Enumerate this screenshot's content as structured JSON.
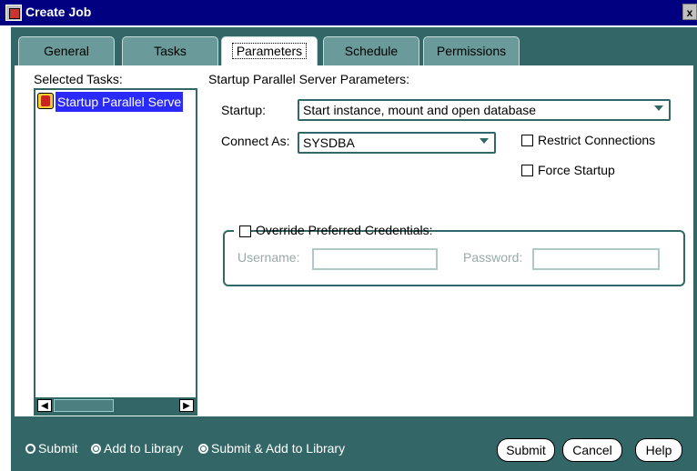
{
  "window": {
    "title": "Create Job",
    "close_label": "x"
  },
  "tabs": [
    {
      "label": "General"
    },
    {
      "label": "Tasks"
    },
    {
      "label": "Parameters"
    },
    {
      "label": "Schedule"
    },
    {
      "label": "Permissions"
    }
  ],
  "active_tab": "Parameters",
  "tasks": {
    "label": "Selected Tasks:",
    "items": [
      {
        "label": "Startup Parallel Serve"
      }
    ]
  },
  "params": {
    "section_label": "Startup Parallel Server Parameters:",
    "startup": {
      "label": "Startup:",
      "value": "Start instance, mount and open database"
    },
    "connect_as": {
      "label": "Connect As:",
      "value": "SYSDBA"
    },
    "restrict_connections": {
      "label": "Restrict Connections",
      "checked": false
    },
    "force_startup": {
      "label": "Force Startup",
      "checked": false
    },
    "override": {
      "label": "Override Preferred Credentials:",
      "checked": false
    },
    "username": {
      "label": "Username:",
      "value": ""
    },
    "password": {
      "label": "Password:",
      "value": ""
    }
  },
  "footer": {
    "options": [
      {
        "label": "Submit",
        "selected": false
      },
      {
        "label": "Add to Library",
        "selected": true
      },
      {
        "label": "Submit & Add to Library",
        "selected": true
      }
    ],
    "buttons": {
      "submit": "Submit",
      "cancel": "Cancel",
      "help": "Help"
    }
  },
  "colors": {
    "titlebar": "#000080",
    "panel": "#336666",
    "selection": "#2a2aff"
  },
  "icons": {
    "app": "app-icon",
    "task": "task-icon",
    "close": "close-icon",
    "dropdown": "chevron-down-icon"
  }
}
